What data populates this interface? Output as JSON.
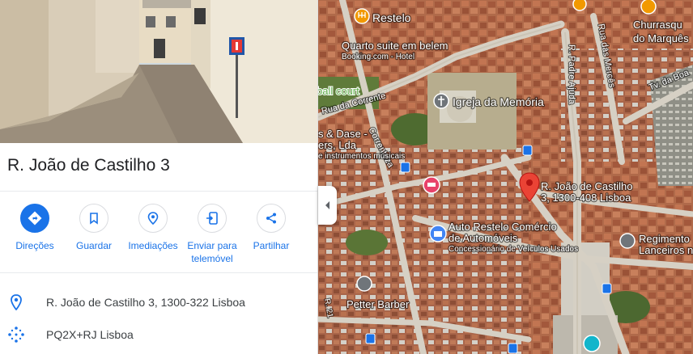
{
  "place": {
    "title": "R. João de Castilho 3"
  },
  "actions": [
    {
      "label": "Direções",
      "icon": "directions-icon"
    },
    {
      "label": "Guardar",
      "icon": "bookmark-icon"
    },
    {
      "label": "Imediações",
      "icon": "nearby-icon"
    },
    {
      "label": "Enviar para telemóvel",
      "label_line1": "Enviar para",
      "label_line2": "telemóvel",
      "icon": "send-to-phone-icon"
    },
    {
      "label": "Partilhar",
      "icon": "share-icon"
    }
  ],
  "info": {
    "address": "R. João de Castilho 3, 1300-322 Lisboa",
    "plus_code": "PQ2X+RJ Lisboa"
  },
  "colors": {
    "accent": "#1a73e8",
    "marker": "#ea4335",
    "restaurant": "#f29900",
    "place_gray": "#70757a"
  },
  "map": {
    "labels": {
      "restelo": "Restelo",
      "quarto_suite": "Quarto suite em belem",
      "booking": "Booking.com - Hotel",
      "ball_court": "ball court",
      "rua_correnteza_1": "Rua da Corrente",
      "rua_correnteza_2": "Correnteza",
      "dase_1": "s & Dase -",
      "dase_2": "ers, Lda",
      "dase_3": "e instrumentos musicais",
      "igreja": "Igreja da Memória",
      "r_ajuda": "R. Padre Ajuda",
      "r_merces": "Rua das Mercês",
      "churrasqueira_1": "Churrasqu",
      "churrasqueira_2": "do Marquês",
      "tv_boa": "Tv. da Boa",
      "marker_line1": "R. João de Castilho",
      "marker_line2": "3, 1300-408 Lisboa",
      "auto_1": "Auto Restelo Comércio",
      "auto_2": "de Automóveis",
      "auto_3": "Concessionário de Veículos Usados",
      "regimento_1": "Regimento",
      "regimento_2": "Lanceiros n",
      "petter": "Petter Barber",
      "r21": "R. 21"
    }
  }
}
